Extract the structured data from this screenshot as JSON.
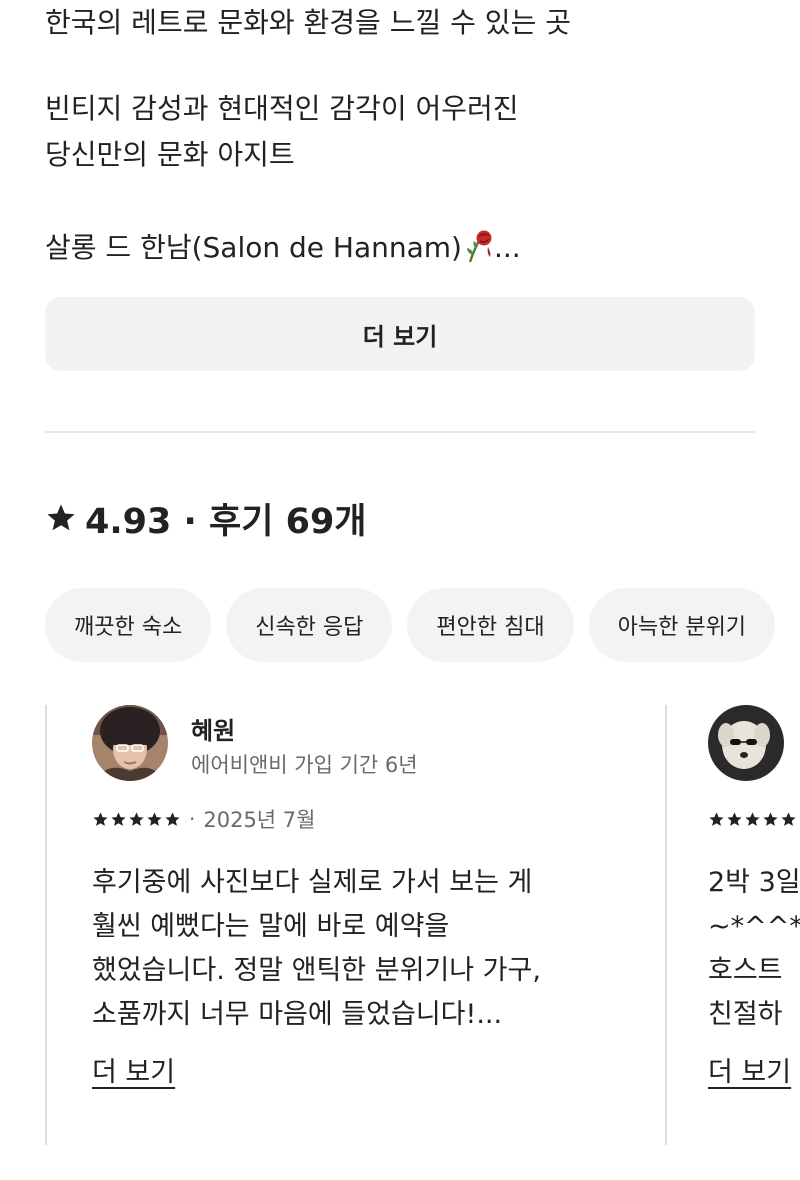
{
  "description": {
    "line1": "한국의 레트로 문화와 환경을 느낄 수 있는 곳",
    "line2": "빈티지 감성과 현대적인 감각이 어우러진",
    "line3": "당신만의 문화 아지트",
    "line4": "살롱 드 한남(Salon de Hannam)",
    "line4_suffix": "...",
    "rose_icon": "wilted-rose-icon"
  },
  "show_more_label": "더 보기",
  "rating": {
    "icon": "star-icon",
    "text": "4.93 · 후기 69개"
  },
  "tags": [
    "깨끗한 숙소",
    "신속한 응답",
    "편안한 침대",
    "아늑한 분위기"
  ],
  "reviews": [
    {
      "name": "혜원",
      "member_since": "에어비앤비 가입 기간 6년",
      "rating": 5,
      "dot": "·",
      "date": "2025년 7월",
      "lines": [
        "후기중에 사진보다 실제로 가서 보는 게",
        "훨씬 예뻤다는 말에 바로 예약을",
        "했었습니다. 정말 앤틱한 분위기나 가구,",
        "소품까지 너무 마음에 들었습니다!..."
      ],
      "more_label": "더 보기"
    },
    {
      "rating": 5,
      "lines": [
        "2박 3일",
        "~*^^*",
        "호스트",
        "친절하"
      ],
      "more_label": "더 보기"
    }
  ],
  "colors": {
    "text": "#222222",
    "muted": "#6a6a6a",
    "button_bg": "#f2f2f2",
    "divider": "#e8e8e8"
  }
}
